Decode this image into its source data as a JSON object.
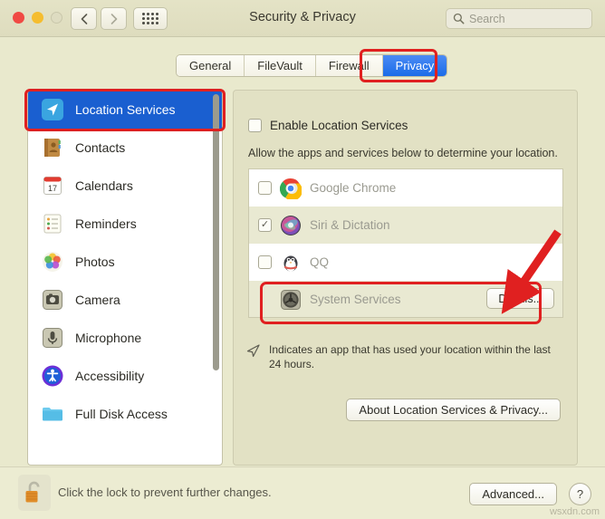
{
  "window": {
    "title": "Security & Privacy",
    "traffic_lights": [
      "close",
      "minimize",
      "zoom"
    ],
    "nav_back": "back-arrow",
    "nav_forward": "forward-arrow",
    "grid_button": "show-all-grid",
    "search": {
      "placeholder": "Search",
      "value": "",
      "icon": "search-icon"
    }
  },
  "tabs": [
    {
      "label": "General",
      "active": false
    },
    {
      "label": "FileVault",
      "active": false
    },
    {
      "label": "Firewall",
      "active": false
    },
    {
      "label": "Privacy",
      "active": true
    }
  ],
  "sidebar": {
    "items": [
      {
        "label": "Location Services",
        "icon": "location-arrow-icon",
        "selected": true
      },
      {
        "label": "Contacts",
        "icon": "contacts-book-icon",
        "selected": false
      },
      {
        "label": "Calendars",
        "icon": "calendar-icon",
        "selected": false
      },
      {
        "label": "Reminders",
        "icon": "reminders-list-icon",
        "selected": false
      },
      {
        "label": "Photos",
        "icon": "photos-flower-icon",
        "selected": false
      },
      {
        "label": "Camera",
        "icon": "camera-icon",
        "selected": false
      },
      {
        "label": "Microphone",
        "icon": "microphone-icon",
        "selected": false
      },
      {
        "label": "Accessibility",
        "icon": "accessibility-icon",
        "selected": false
      },
      {
        "label": "Full Disk Access",
        "icon": "folder-icon",
        "selected": false
      }
    ]
  },
  "panel": {
    "enable_checkbox": {
      "label": "Enable Location Services",
      "checked": false,
      "mark": ""
    },
    "description": "Allow the apps and services below to determine your location.",
    "apps": [
      {
        "name": "Google Chrome",
        "checked": false,
        "mark": "",
        "icon": "chrome-icon",
        "has_checkbox": true,
        "button": null
      },
      {
        "name": "Siri & Dictation",
        "checked": true,
        "mark": "✓",
        "icon": "siri-icon",
        "has_checkbox": true,
        "button": null
      },
      {
        "name": "QQ",
        "checked": false,
        "mark": "",
        "icon": "qq-penguin-icon",
        "has_checkbox": true,
        "button": null
      },
      {
        "name": "System Services",
        "checked": false,
        "mark": "",
        "icon": "system-services-gear-icon",
        "has_checkbox": false,
        "button": "Details..."
      }
    ],
    "note": "Indicates an app that has used your location within the last 24 hours.",
    "note_icon": "location-arrow-indicator-icon",
    "about_button": "About Location Services & Privacy..."
  },
  "bottom": {
    "lock_icon": "unlocked-padlock-icon",
    "lock_message": "Click the lock to prevent further changes.",
    "advanced_button": "Advanced...",
    "help_button": "?"
  },
  "watermark": "wsxdn.com",
  "colors": {
    "accent_blue": "#1a5fd0",
    "tab_active_blue": "#1b6ce8",
    "highlight_red": "#e02020",
    "window_bg": "#e9e9cd",
    "panel_bg": "#e2e1c4"
  }
}
